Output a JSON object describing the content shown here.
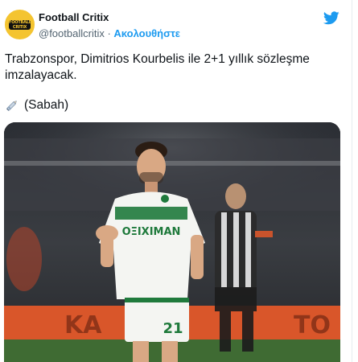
{
  "author": {
    "display_name": "Football Critix",
    "handle": "@footballcritix",
    "separator": "·",
    "follow_label": "Ακολουθήστε",
    "avatar_label": "FOOTBALL CRITIX"
  },
  "tweet": {
    "text": "Trabzonspor, Dimitrios Kourbelis ile 2+1 yıllık sözleşme imzalayacak.",
    "source": "(Sabah)"
  },
  "media": {
    "alt_subject": "footballer-photo",
    "jersey_sponsor": "OΞIXIMAN",
    "jersey_number": "21",
    "banner_left": "KA",
    "banner_right": "TO"
  },
  "colors": {
    "accent": "#1d9bf0",
    "text": "#0f1419",
    "muted": "#536471",
    "jersey_green": "#1f7a3c",
    "banner_orange": "#d9562a"
  },
  "icons": {
    "twitter": "twitter-bird-icon",
    "source": "pen-icon"
  }
}
